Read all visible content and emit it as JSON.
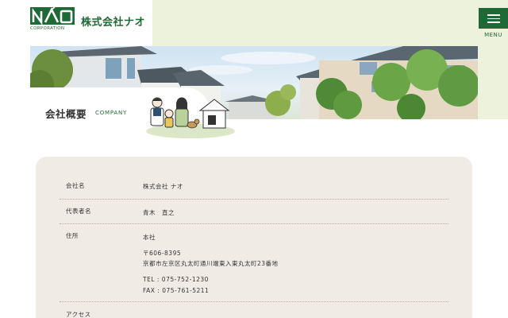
{
  "header": {
    "logo_text": "NAO",
    "logo_sub": "CORPORATION",
    "company_name": "株式会社ナオ",
    "menu_label": "MENU"
  },
  "hero": {
    "title": "会社概要",
    "subtitle": "COMPANY"
  },
  "company_info": {
    "rows": [
      {
        "label": "会社名",
        "value": "株式会社 ナオ"
      },
      {
        "label": "代表者名",
        "value": "青木　直之"
      },
      {
        "label": "住所",
        "office": "本社",
        "postal": "〒606-8395",
        "address": "京都市左京区丸太町通川端東入東丸太町23番地",
        "tel": "TEL : 075-752-1230",
        "fax": "FAX : 075-761-5211"
      },
      {
        "label": "アクセス"
      }
    ]
  },
  "colors": {
    "brand_green": "#1d6a36",
    "light_green": "#ecf2dc",
    "card_bg": "#f1ebe5"
  }
}
